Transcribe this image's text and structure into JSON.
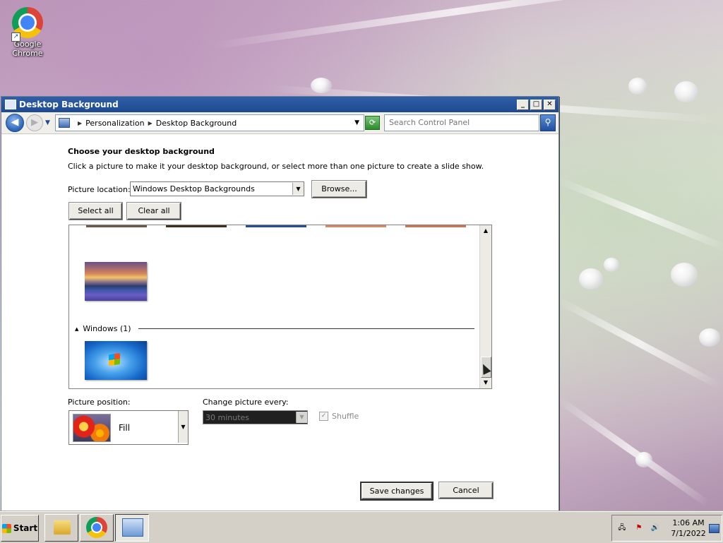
{
  "desktop": {
    "icon_label": "Google Chrome"
  },
  "window": {
    "title": "Desktop Background",
    "controls": [
      "_",
      "□",
      "✕"
    ]
  },
  "addressbar": {
    "breadcrumbs": [
      "Personalization",
      "Desktop Background"
    ],
    "search_placeholder": "Search Control Panel"
  },
  "main": {
    "heading": "Choose your desktop background",
    "subtext": "Click a picture to make it your desktop background, or select more than one picture to create a slide show.",
    "picture_location_label": "Picture location:",
    "picture_location_value": "Windows Desktop Backgrounds",
    "browse_label": "Browse...",
    "select_all_label": "Select all",
    "clear_all_label": "Clear all",
    "group_windows_label": "Windows (1)",
    "picture_position_label": "Picture position:",
    "picture_position_value": "Fill",
    "change_picture_label": "Change picture every:",
    "change_picture_value": "30 minutes",
    "shuffle_label": "Shuffle",
    "shuffle_checked": true,
    "save_label": "Save changes",
    "cancel_label": "Cancel"
  },
  "taskbar": {
    "start_label": "Start",
    "time": "1:06 AM",
    "date": "7/1/2022"
  },
  "colors": {
    "titlebar": "#2f5fa8",
    "taskbar": "#d4d0c8"
  }
}
